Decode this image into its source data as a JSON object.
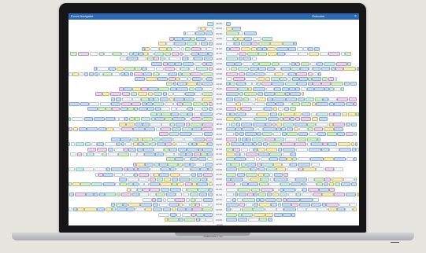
{
  "window": {
    "title": "Event Navigator",
    "panel_title": "Outcome",
    "close_glyph": "×"
  },
  "device": {
    "brand": "MacBook Pro"
  },
  "schedule": {
    "times": [
      "08:00 - 9:00",
      "09:00 - 9:30",
      "09:30 - 10:00",
      "10:00 - 10:30",
      "10:30 - 11:00",
      "11:00 - 11:30",
      "11:30 - 12:00",
      "12:00 - 12:30",
      "12:30 - 13:00",
      "13:00 - 13:30",
      "13:30 - 14:00",
      "14:00 - 14:30",
      "14:30 - 15:00",
      "15:00 - 15:30",
      "15:30 - 16:00",
      "16:00 - 16:30",
      "16:30 - 17:00",
      "17:00 - 17:30",
      "17:30 - 18:00",
      "18:00 - 18:30",
      "18:30 - 19:00",
      "19:00 - 19:30",
      "19:30 - 20:00",
      "20:00 - 20:30",
      "20:30 - 21:00",
      "21:00 - 21:30",
      "21:30 - 22:00",
      "22:00 - 22:30",
      "22:30 - 23:00",
      "23:00 - 23:30",
      "23:30 - 24:00",
      "00:00 - 00:30",
      "00:30 - 01:00",
      "01:00 - 01:30",
      "01:30 - 02:00",
      "02:00 - 02:30",
      "02:30 - 03:00",
      "03:00 - 03:30",
      "03:30 - 04:00",
      "04:00 - 04:30"
    ]
  }
}
